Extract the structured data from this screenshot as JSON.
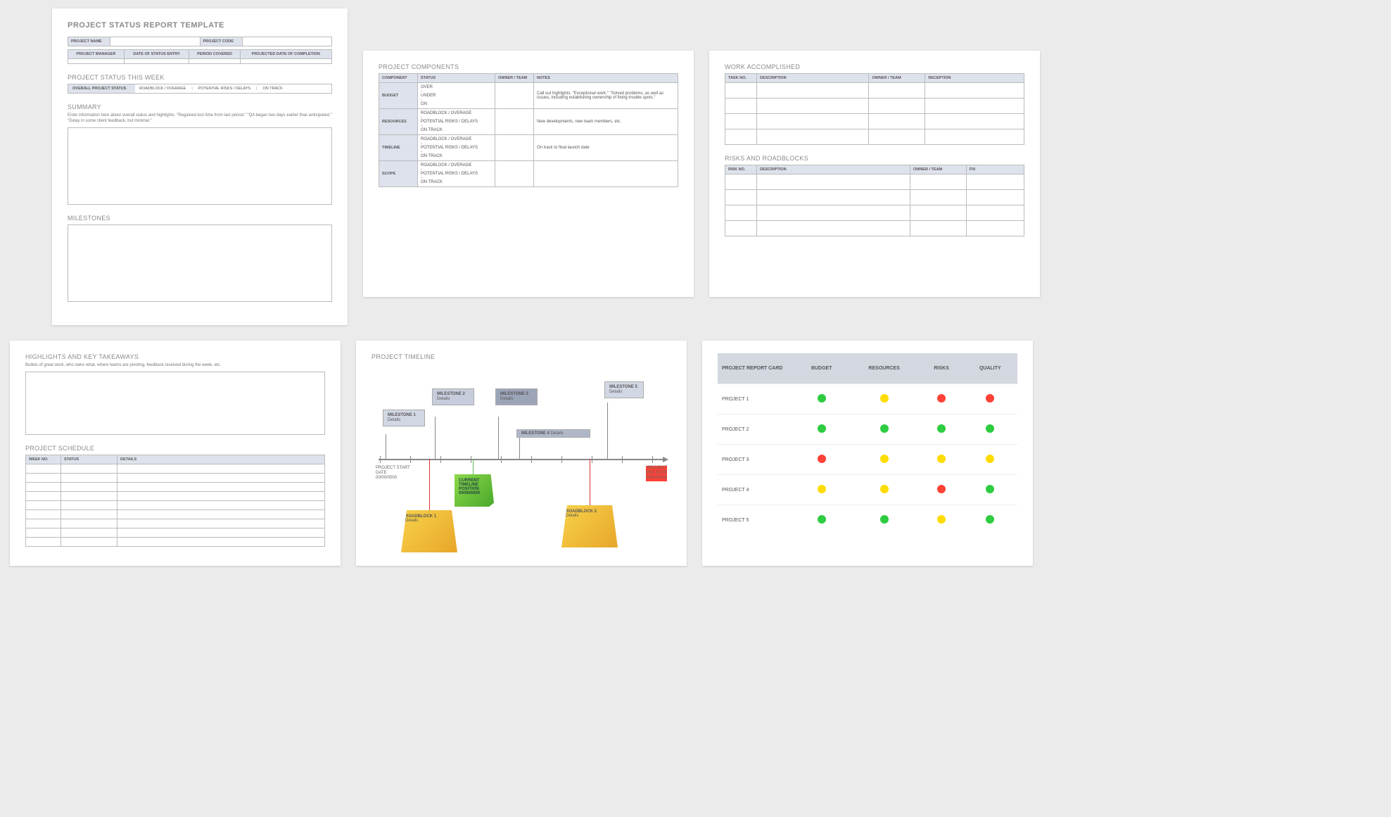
{
  "page1": {
    "title": "PROJECT STATUS REPORT TEMPLATE",
    "hdr": {
      "projectName": "PROJECT NAME",
      "projectCode": "PROJECT CODE",
      "projectManager": "PROJECT MANAGER",
      "dateEntry": "DATE OF STATUS ENTRY",
      "periodCovered": "PERIOD COVERED",
      "projectedCompletion": "PROJECTED DATE OF COMPLETION"
    },
    "statusWeek": {
      "title": "PROJECT STATUS THIS WEEK",
      "overall": "OVERALL PROJECT STATUS",
      "opt1": "ROADBLOCK / OVERAGE",
      "opt2": "POTENTIAL RISKS / DELAYS",
      "opt3": "ON TRACK"
    },
    "summary": {
      "title": "SUMMARY",
      "desc": "Enter information here about overall status and highlights: \"Regained lost time from last period.\" \"QA began two days earlier than anticipated.\" \"Delay in some client feedback, but minimal.\""
    },
    "milestones": {
      "title": "MILESTONES"
    }
  },
  "page2": {
    "title": "PROJECT COMPONENTS",
    "headers": {
      "component": "COMPONENT",
      "status": "STATUS",
      "owner": "OWNER / TEAM",
      "notes": "NOTES"
    },
    "rows": [
      {
        "comp": "BUDGET",
        "status": "OVER\n-\nUNDER\n-\nON",
        "notes": "Call out highlights: \"Exceptional work.\" \"Solved problems, as well as issues, including establishing ownership of fixing trouble spots.\""
      },
      {
        "comp": "RESOURCES",
        "status": "ROADBLOCK / OVERAGE\n-\nPOTENTIAL RISKS / DELAYS\n-\nON TRACK",
        "notes": "New developments, new team members, etc."
      },
      {
        "comp": "TIMELINE",
        "status": "ROADBLOCK / OVERAGE\n-\nPOTENTIAL RISKS / DELAYS\n-\nON TRACK",
        "notes": "On track to final launch date"
      },
      {
        "comp": "SCOPE",
        "status": "ROADBLOCK / OVERAGE\n-\nPOTENTIAL RISKS / DELAYS\n-\nON TRACK",
        "notes": ""
      }
    ]
  },
  "page3": {
    "work": {
      "title": "WORK ACCOMPLISHED",
      "headers": {
        "task": "TASK NO.",
        "desc": "DESCRIPTION",
        "owner": "OWNER / TEAM",
        "recep": "RECEPTION"
      }
    },
    "risks": {
      "title": "RISKS AND ROADBLOCKS",
      "headers": {
        "risk": "RISK NO.",
        "desc": "DESCRIPTION",
        "owner": "OWNER / TEAM",
        "fix": "FIX"
      }
    }
  },
  "page4": {
    "hi": {
      "title": "HIGHLIGHTS AND KEY TAKEAWAYS",
      "desc": "Bullets of great work, who owns what, where teams are pivoting, feedback received during the week, etc."
    },
    "sched": {
      "title": "PROJECT SCHEDULE",
      "headers": {
        "week": "WEEK NO.",
        "status": "STATUS",
        "details": "DETAILS"
      }
    }
  },
  "page5": {
    "title": "PROJECT TIMELINE",
    "start": {
      "l1": "PROJECT START",
      "l2": "DATE",
      "l3": "00/00/0000"
    },
    "end": {
      "l1": "PROJECT",
      "l2": "END DATE",
      "l3": "00/00/0000"
    },
    "ms": [
      {
        "t": "MILESTONE 1",
        "d": "Details"
      },
      {
        "t": "MILESTONE 2",
        "d": "Details"
      },
      {
        "t": "MILESTONE 3",
        "d": "Details"
      },
      {
        "t": "MILESTONE 4",
        "d": "Details"
      },
      {
        "t": "MILESTONE 5",
        "d": "Details"
      }
    ],
    "cur": {
      "l1": "CURRENT",
      "l2": "TIMELINE",
      "l3": "POSITION",
      "l4": "00/00/0000"
    },
    "rb": [
      {
        "t": "ROADBLOCK 1",
        "d": "Details"
      },
      {
        "t": "ROADBLOCK 2",
        "d": "Details"
      }
    ]
  },
  "page6": {
    "headers": {
      "card": "PROJECT REPORT CARD",
      "budget": "BUDGET",
      "resources": "RESOURCES",
      "risks": "RISKS",
      "quality": "QUALITY"
    },
    "rows": [
      {
        "name": "PROJECT 1",
        "v": [
          "g",
          "y",
          "r",
          "r"
        ]
      },
      {
        "name": "PROJECT 2",
        "v": [
          "g",
          "g",
          "g",
          "g"
        ]
      },
      {
        "name": "PROJECT 3",
        "v": [
          "r",
          "y",
          "y",
          "y"
        ]
      },
      {
        "name": "PROJECT 4",
        "v": [
          "y",
          "y",
          "r",
          "g"
        ]
      },
      {
        "name": "PROJECT 5",
        "v": [
          "g",
          "g",
          "y",
          "g"
        ]
      }
    ]
  }
}
